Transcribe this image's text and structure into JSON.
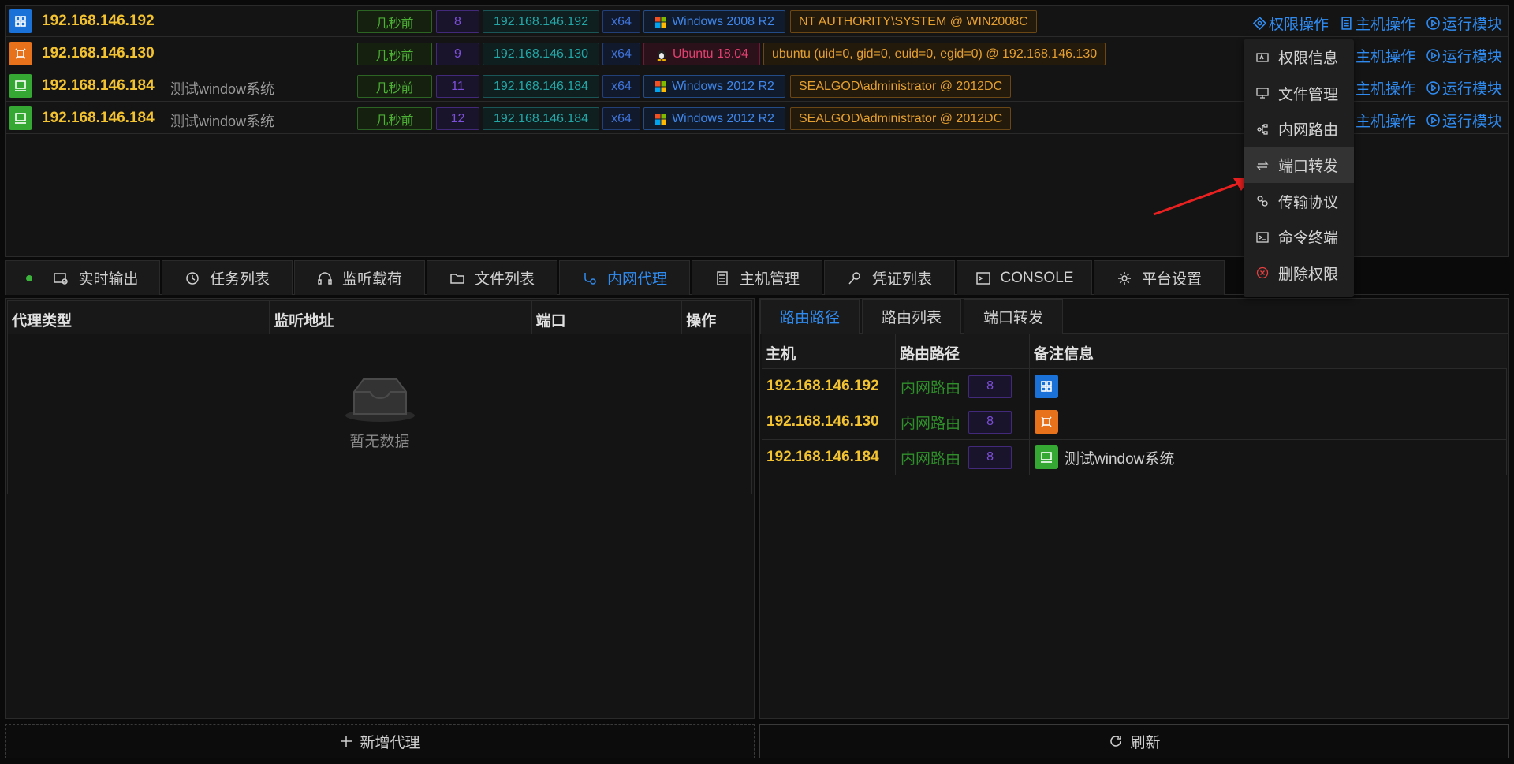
{
  "sessions": [
    {
      "os_type": "win",
      "icon": "windows-icon",
      "ip": "192.168.146.192",
      "note": "",
      "time": "几秒前",
      "pid": "8",
      "address": "192.168.146.192",
      "arch": "x64",
      "os": "Windows 2008 R2",
      "user": "NT AUTHORITY\\SYSTEM @ WIN2008C"
    },
    {
      "os_type": "linux",
      "icon": "linux-icon",
      "ip": "192.168.146.130",
      "note": "",
      "time": "几秒前",
      "pid": "9",
      "address": "192.168.146.130",
      "arch": "x64",
      "os": "Ubuntu 18.04",
      "user": "ubuntu (uid=0, gid=0, euid=0, egid=0) @ 192.168.146.130"
    },
    {
      "os_type": "host",
      "icon": "monitor-icon",
      "ip": "192.168.146.184",
      "note": "测试window系统",
      "time": "几秒前",
      "pid": "11",
      "address": "192.168.146.184",
      "arch": "x64",
      "os": "Windows 2012 R2",
      "user": "SEALGOD\\administrator @ 2012DC"
    },
    {
      "os_type": "host",
      "icon": "monitor-icon",
      "ip": "192.168.146.184",
      "note": "测试window系统",
      "time": "几秒前",
      "pid": "12",
      "address": "192.168.146.184",
      "arch": "x64",
      "os": "Windows 2012 R2",
      "user": "SEALGOD\\administrator @ 2012DC"
    }
  ],
  "ops": {
    "permission": "权限操作",
    "host": "主机操作",
    "module": "运行模块"
  },
  "context_menu": [
    {
      "label": "权限信息",
      "icon": "info-card-icon"
    },
    {
      "label": "文件管理",
      "icon": "monitor-icon"
    },
    {
      "label": "内网路由",
      "icon": "network-icon"
    },
    {
      "label": "端口转发",
      "icon": "swap-icon"
    },
    {
      "label": "传输协议",
      "icon": "protocol-icon"
    },
    {
      "label": "命令终端",
      "icon": "terminal-icon"
    },
    {
      "label": "删除权限",
      "icon": "delete-icon"
    }
  ],
  "tabs": [
    {
      "label": "实时输出",
      "icon": "output-icon"
    },
    {
      "label": "任务列表",
      "icon": "clock-icon"
    },
    {
      "label": "监听载荷",
      "icon": "headset-icon"
    },
    {
      "label": "文件列表",
      "icon": "folder-icon"
    },
    {
      "label": "内网代理",
      "icon": "proxy-icon"
    },
    {
      "label": "主机管理",
      "icon": "server-icon"
    },
    {
      "label": "凭证列表",
      "icon": "key-icon"
    },
    {
      "label": "CONSOLE",
      "icon": "console-icon"
    },
    {
      "label": "平台设置",
      "icon": "gear-icon"
    }
  ],
  "proxy": {
    "columns": [
      "代理类型",
      "监听地址",
      "端口",
      "操作"
    ],
    "empty_text": "暂无数据",
    "add_label": "新增代理"
  },
  "route": {
    "subtabs": [
      "路由路径",
      "路由列表",
      "端口转发"
    ],
    "columns": [
      "主机",
      "路由路径",
      "备注信息"
    ],
    "rows": [
      {
        "host": "192.168.146.192",
        "path": "内网路由",
        "pid": "8",
        "os_type": "win",
        "remark": ""
      },
      {
        "host": "192.168.146.130",
        "path": "内网路由",
        "pid": "8",
        "os_type": "linux",
        "remark": ""
      },
      {
        "host": "192.168.146.184",
        "path": "内网路由",
        "pid": "8",
        "os_type": "host",
        "remark": "测试window系统"
      }
    ],
    "refresh_label": "刷新"
  },
  "colors": {
    "accent": "#2f8bf0",
    "ip": "#f2c230",
    "win": "#1a72d8",
    "linux": "#e8721c",
    "host": "#34a832"
  }
}
